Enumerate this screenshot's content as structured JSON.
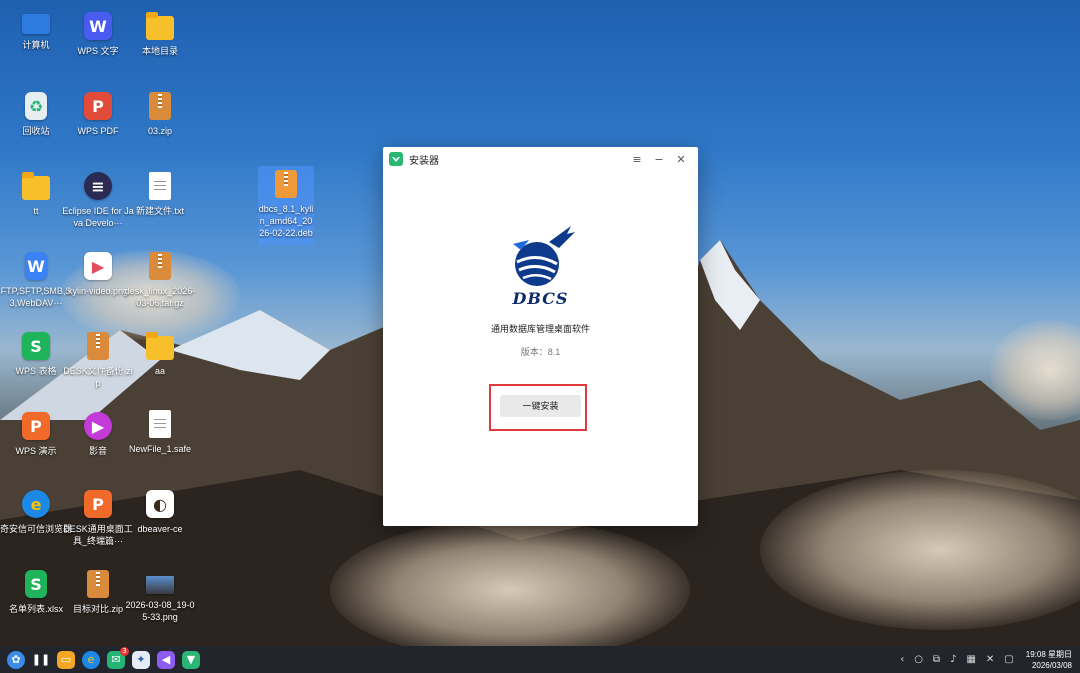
{
  "desktop": {
    "icons": [
      {
        "label": "计算机"
      },
      {
        "label": "WPS 文字"
      },
      {
        "label": "本地目录"
      },
      {
        "label": "回收站"
      },
      {
        "label": "WPS PDF"
      },
      {
        "label": "03.zip"
      },
      {
        "label": "tt"
      },
      {
        "label": "Eclipse IDE for Java Develo···"
      },
      {
        "label": "新建文件.txt"
      },
      {
        "label": "dbcs_8.1_kylin_amd64_2026-02-22.deb"
      },
      {
        "label": "FTP,SFTP,SMB,S3,WebDAV···"
      },
      {
        "label": "kylin-video.png"
      },
      {
        "label": "desk_linux_2026-03-06.tar.gz"
      },
      {
        "label": "WPS 表格"
      },
      {
        "label": "DESK文件备份.zip"
      },
      {
        "label": "aa"
      },
      {
        "label": "WPS 演示"
      },
      {
        "label": "影音"
      },
      {
        "label": "NewFile_1.safe"
      },
      {
        "label": "奇安信可信浏览器"
      },
      {
        "label": "DESK通用桌面工具_终端篇···"
      },
      {
        "label": "dbeaver-ce"
      },
      {
        "label": "名单列表.xlsx"
      },
      {
        "label": "目标对比.zip"
      },
      {
        "label": "2026-03-08_19-05-33.png"
      }
    ]
  },
  "installer": {
    "title": "安装器",
    "logo_text": "DBCS",
    "description": "通用数据库管理桌面软件",
    "version_label": "版本：8.1",
    "install_button": "一键安装",
    "menu_symbol": "≡",
    "minimize_symbol": "−",
    "close_symbol": "✕"
  },
  "taskbar": {
    "mail_badge": "3",
    "time": "19:08 星期日",
    "date": "2026/03/08"
  },
  "colors": {
    "accent_green": "#2bb673",
    "highlight_red": "#e0393e",
    "taskbar_bg": "#22252c"
  }
}
